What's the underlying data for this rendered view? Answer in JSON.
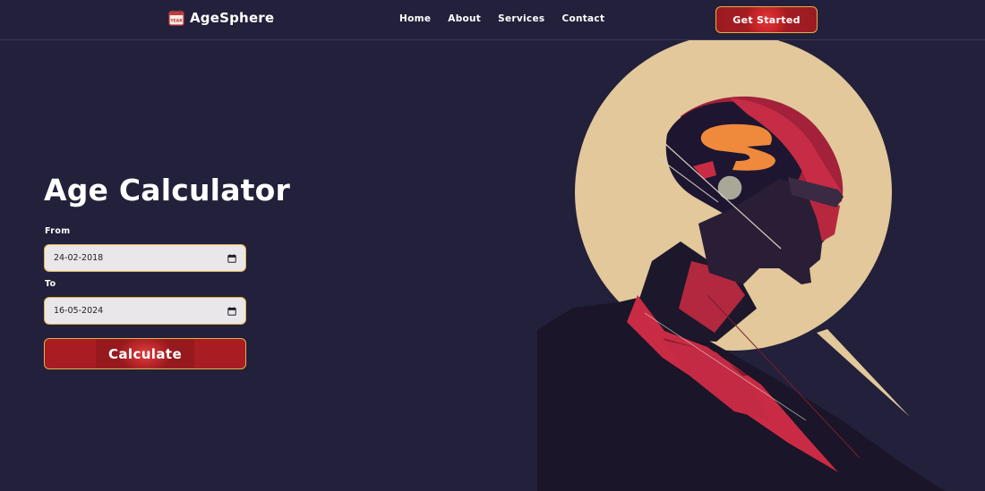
{
  "nav": {
    "brand": "AgeSphere",
    "logo_text": "YEAR",
    "links": [
      "Home",
      "About",
      "Services",
      "Contact"
    ],
    "cta": "Get Started"
  },
  "form": {
    "title": "Age Calculator",
    "from_label": "From",
    "from_value": "24-02-2018",
    "to_label": "To",
    "to_value": "16-05-2024",
    "submit": "Calculate"
  },
  "colors": {
    "background": "#22203a",
    "accent_red": "#a31c22",
    "accent_gold": "#e2b14a",
    "halo": "#e2c89a",
    "brain_orange": "#ef8a3c"
  },
  "icons": {
    "logo": "calendar-year-icon",
    "date_picker": "calendar-icon",
    "hero": "robotic-head-illustration"
  }
}
